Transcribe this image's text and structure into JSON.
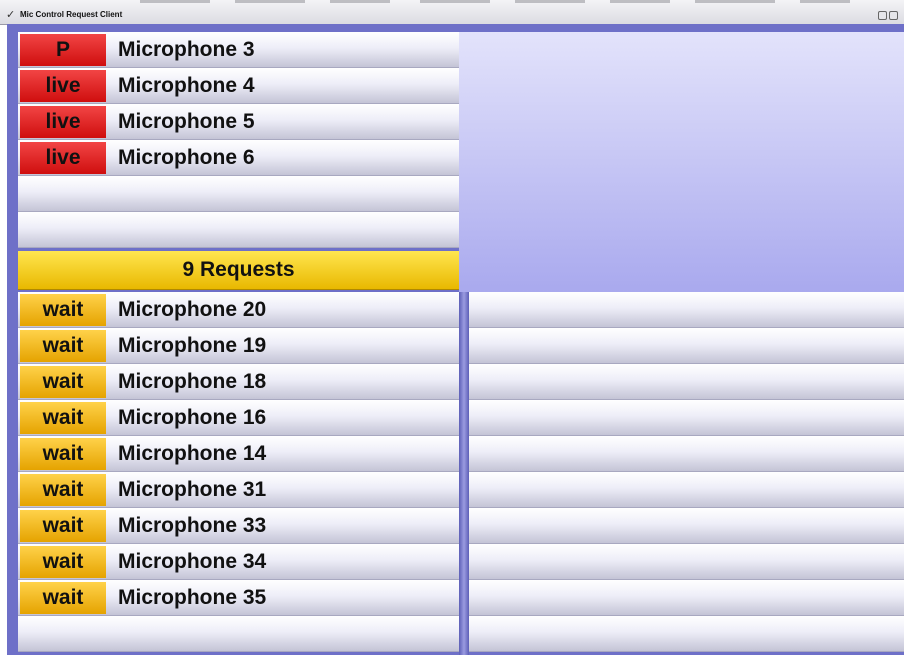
{
  "window": {
    "title": "Mic Control Request Client"
  },
  "active_mics": [
    {
      "status": "P",
      "name": "Microphone 3"
    },
    {
      "status": "live",
      "name": "Microphone 4"
    },
    {
      "status": "live",
      "name": "Microphone 5"
    },
    {
      "status": "live",
      "name": "Microphone 6"
    },
    {
      "status": "",
      "name": ""
    },
    {
      "status": "",
      "name": ""
    }
  ],
  "requests": {
    "header": "9 Requests",
    "items": [
      {
        "status": "wait",
        "name": "Microphone 20"
      },
      {
        "status": "wait",
        "name": "Microphone 19"
      },
      {
        "status": "wait",
        "name": "Microphone 18"
      },
      {
        "status": "wait",
        "name": "Microphone 16"
      },
      {
        "status": "wait",
        "name": "Microphone 14"
      },
      {
        "status": "wait",
        "name": "Microphone 31"
      },
      {
        "status": "wait",
        "name": "Microphone 33"
      },
      {
        "status": "wait",
        "name": "Microphone 34"
      },
      {
        "status": "wait",
        "name": "Microphone 35"
      },
      {
        "status": "",
        "name": ""
      }
    ]
  },
  "colors": {
    "live": "#e01e1e",
    "wait": "#f1b70c",
    "header": "#f7d21c",
    "background": "#6e70c8"
  }
}
